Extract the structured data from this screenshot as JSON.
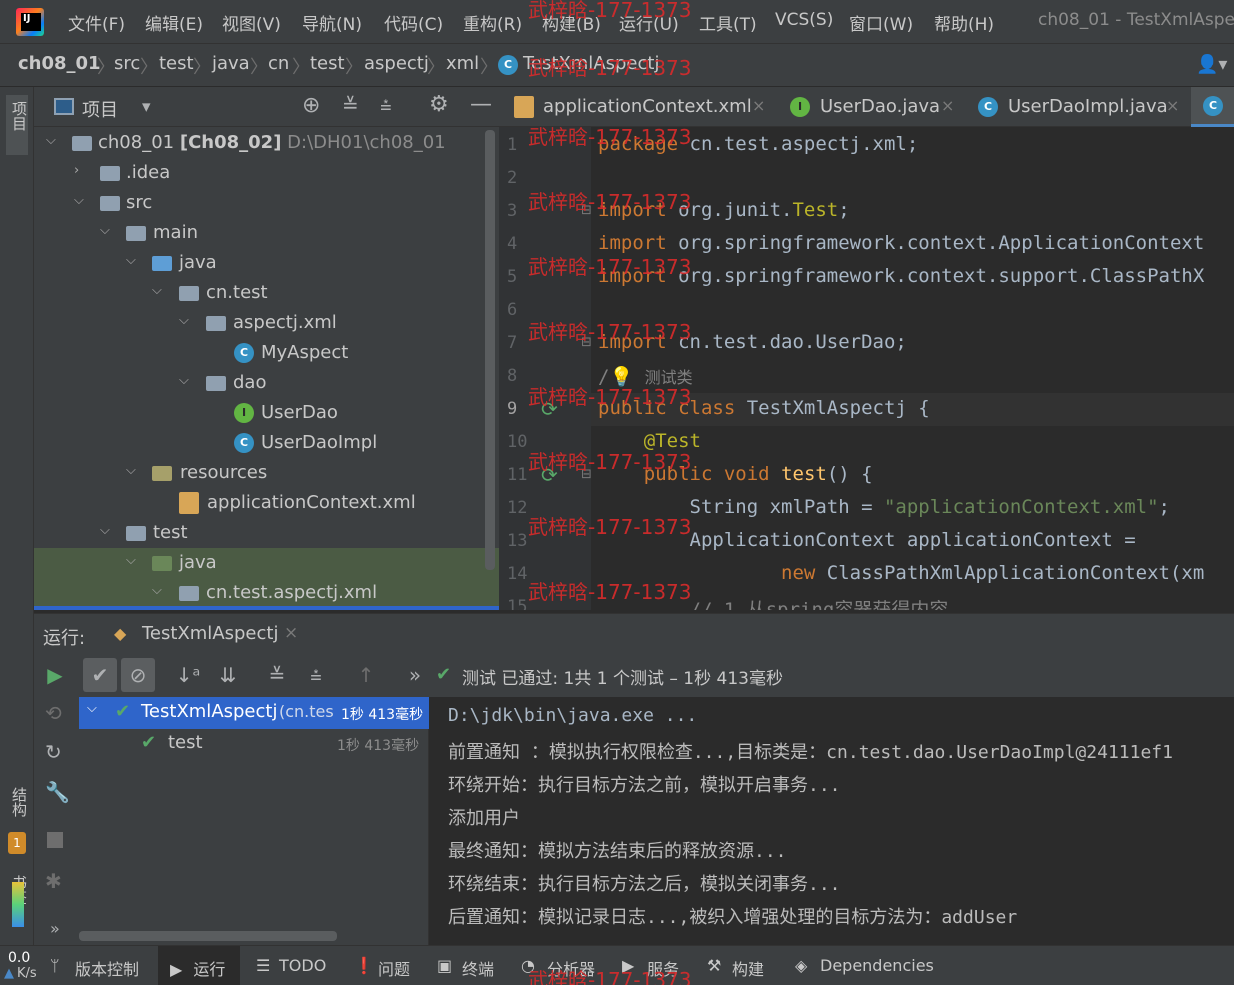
{
  "menubar": {
    "items": [
      "文件(F)",
      "编辑(E)",
      "视图(V)",
      "导航(N)",
      "代码(C)",
      "重构(R)",
      "构建(B)",
      "运行(U)",
      "工具(T)",
      "VCS(S)",
      "窗口(W)",
      "帮助(H)"
    ],
    "window_title": "ch08_01 - TestXmlAspe"
  },
  "breadcrumb": [
    "ch08_01",
    "src",
    "test",
    "java",
    "cn",
    "test",
    "aspectj",
    "xml",
    "TestXmlAspectj"
  ],
  "project_panel": {
    "title": "项目",
    "left_tab": "项目",
    "tree": [
      {
        "label": "ch08_01",
        "bold": "[Ch08_02]",
        "path": "D:\\DH01\\ch08_01",
        "indent": 0,
        "arrow": "down",
        "icon": "folder"
      },
      {
        "label": ".idea",
        "indent": 1,
        "arrow": "right",
        "icon": "folder"
      },
      {
        "label": "src",
        "indent": 1,
        "arrow": "down",
        "icon": "folder"
      },
      {
        "label": "main",
        "indent": 2,
        "arrow": "down",
        "icon": "folder"
      },
      {
        "label": "java",
        "indent": 3,
        "arrow": "down",
        "icon": "folder-blue"
      },
      {
        "label": "cn.test",
        "indent": 4,
        "arrow": "down",
        "icon": "package"
      },
      {
        "label": "aspectj.xml",
        "indent": 5,
        "arrow": "down",
        "icon": "package"
      },
      {
        "label": "MyAspect",
        "indent": 6,
        "arrow": "",
        "icon": "class"
      },
      {
        "label": "dao",
        "indent": 5,
        "arrow": "down",
        "icon": "package"
      },
      {
        "label": "UserDao",
        "indent": 6,
        "arrow": "",
        "icon": "interface"
      },
      {
        "label": "UserDaoImpl",
        "indent": 6,
        "arrow": "",
        "icon": "class"
      },
      {
        "label": "resources",
        "indent": 3,
        "arrow": "down",
        "icon": "folder-res"
      },
      {
        "label": "applicationContext.xml",
        "indent": 4,
        "arrow": "",
        "icon": "xml"
      },
      {
        "label": "test",
        "indent": 2,
        "arrow": "down",
        "icon": "folder"
      },
      {
        "label": "java",
        "indent": 3,
        "arrow": "down",
        "icon": "folder-green",
        "selected": true
      },
      {
        "label": "cn.test.aspectj.xml",
        "indent": 4,
        "arrow": "down",
        "icon": "package",
        "selected": true
      }
    ]
  },
  "editor_tabs": [
    {
      "label": "applicationContext.xml",
      "icon": "xml-icon"
    },
    {
      "label": "UserDao.java",
      "icon": "interface-icon"
    },
    {
      "label": "UserDaoImpl.java",
      "icon": "class-icon"
    }
  ],
  "code_lines": [
    {
      "n": "1",
      "t": "package cn.test.aspectj.xml;"
    },
    {
      "n": "2",
      "t": ""
    },
    {
      "n": "3",
      "t": "import org.junit.Test;"
    },
    {
      "n": "4",
      "t": "import org.springframework.context.ApplicationContext"
    },
    {
      "n": "5",
      "t": "import org.springframework.context.support.ClassPathX"
    },
    {
      "n": "6",
      "t": ""
    },
    {
      "n": "7",
      "t": "import cn.test.dao.UserDao;"
    },
    {
      "n": "8",
      "t": "/  测试类"
    },
    {
      "n": "9",
      "t": "public class TestXmlAspectj {"
    },
    {
      "n": "10",
      "t": "    @Test"
    },
    {
      "n": "11",
      "t": "    public void test() {"
    },
    {
      "n": "12",
      "t": "        String xmlPath = \"applicationContext.xml\";"
    },
    {
      "n": "13",
      "t": "        ApplicationContext applicationContext ="
    },
    {
      "n": "14",
      "t": "                new ClassPathXmlApplicationContext(xm"
    },
    {
      "n": "15",
      "t": "        // 1 从spring容器获得内容"
    }
  ],
  "watermark": "武梓晗-177-1373",
  "run_panel": {
    "label": "运行:",
    "tab": "TestXmlAspectj",
    "status": "测试 已通过: 1共 1 个测试 – 1秒 413毫秒",
    "tests": [
      {
        "label": "TestXmlAspectj",
        "sub": "(cn.tes",
        "time": "1秒 413毫秒"
      },
      {
        "label": "test",
        "time": "1秒 413毫秒"
      }
    ],
    "console": [
      "D:\\jdk\\bin\\java.exe ...",
      "前置通知 ：模拟执行权限检查...,目标类是：cn.test.dao.UserDaoImpl@24111ef1",
      "环绕开始：执行目标方法之前，模拟开启事务...",
      "添加用户",
      "最终通知：模拟方法结束后的释放资源...",
      "环绕结束：执行目标方法之后，模拟关闭事务...",
      "后置通知：模拟记录日志...,被织入增强处理的目标方法为：addUser"
    ]
  },
  "left_vertical": [
    "结构",
    "书签"
  ],
  "statusbar": {
    "speed_value": "0.0",
    "speed_unit": "K/s",
    "items": [
      "版本控制",
      "运行",
      "TODO",
      "问题",
      "终端",
      "分析器",
      "服务",
      "构建",
      "Dependencies"
    ]
  }
}
